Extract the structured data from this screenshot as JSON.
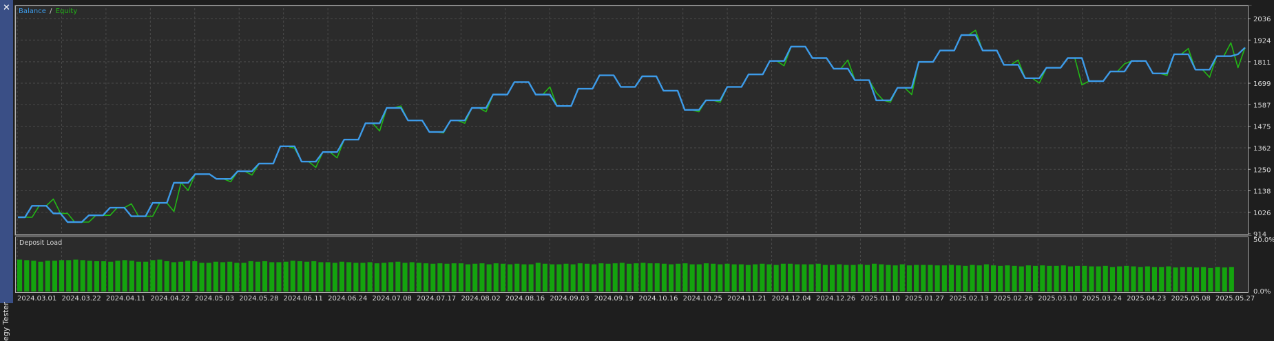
{
  "window": {
    "side_title": "egy Tester",
    "close_icon": "close-icon",
    "accent_color": "#3a4f86"
  },
  "legend": {
    "balance_label": "Balance",
    "separator": "/",
    "equity_label": "Equity"
  },
  "subchart": {
    "title": "Deposit Load"
  },
  "chart_data": [
    {
      "type": "line",
      "title": "",
      "legend": [
        "Balance",
        "Equity"
      ],
      "legend_position": "top-left",
      "grid": true,
      "ylim": [
        914,
        2090
      ],
      "y_ticks": [
        "914",
        "1026",
        "1138",
        "1250",
        "1362",
        "1475",
        "1587",
        "1699",
        "1811",
        "1924",
        "2036"
      ],
      "x_ticks": [
        "2024.03.01",
        "2024.03.22",
        "2024.04.11",
        "2024.04.22",
        "2024.05.03",
        "2024.05.28",
        "2024.06.11",
        "2024.06.24",
        "2024.07.08",
        "2024.07.17",
        "2024.08.02",
        "2024.08.16",
        "2024.09.03",
        "2024.09.19",
        "2024.10.16",
        "2024.10.25",
        "2024.11.21",
        "2024.12.04",
        "2024.12.26",
        "2025.01.10",
        "2025.01.27",
        "2025.02.13",
        "2025.02.26",
        "2025.03.10",
        "2025.03.24",
        "2025.04.23",
        "2025.05.08",
        "2025.05.27"
      ],
      "series": [
        {
          "name": "Balance",
          "color": "#3d9be9",
          "values": [
            1000,
            1000,
            1060,
            1060,
            1060,
            1020,
            1020,
            975,
            975,
            975,
            1010,
            1010,
            1010,
            1050,
            1050,
            1050,
            1005,
            1005,
            1005,
            1075,
            1075,
            1075,
            1180,
            1180,
            1180,
            1225,
            1225,
            1225,
            1200,
            1200,
            1200,
            1240,
            1240,
            1240,
            1280,
            1280,
            1280,
            1370,
            1370,
            1370,
            1290,
            1290,
            1290,
            1340,
            1340,
            1340,
            1405,
            1405,
            1405,
            1490,
            1490,
            1490,
            1570,
            1570,
            1570,
            1505,
            1505,
            1505,
            1445,
            1445,
            1445,
            1505,
            1505,
            1505,
            1570,
            1570,
            1570,
            1640,
            1640,
            1640,
            1705,
            1705,
            1705,
            1640,
            1640,
            1640,
            1580,
            1580,
            1580,
            1670,
            1670,
            1670,
            1740,
            1740,
            1740,
            1680,
            1680,
            1680,
            1735,
            1735,
            1735,
            1660,
            1660,
            1660,
            1560,
            1560,
            1560,
            1610,
            1610,
            1610,
            1680,
            1680,
            1680,
            1745,
            1745,
            1745,
            1815,
            1815,
            1815,
            1890,
            1890,
            1890,
            1830,
            1830,
            1830,
            1775,
            1775,
            1775,
            1715,
            1715,
            1715,
            1610,
            1610,
            1610,
            1675,
            1675,
            1675,
            1810,
            1810,
            1810,
            1870,
            1870,
            1870,
            1950,
            1950,
            1950,
            1870,
            1870,
            1870,
            1795,
            1795,
            1795,
            1725,
            1725,
            1725,
            1780,
            1780,
            1780,
            1830,
            1830,
            1830,
            1710,
            1710,
            1710,
            1760,
            1760,
            1760,
            1815,
            1815,
            1815,
            1750,
            1750,
            1750,
            1850,
            1850,
            1850,
            1770,
            1770,
            1770,
            1840,
            1840,
            1840,
            1850,
            1885
          ]
        },
        {
          "name": "Equity",
          "color": "#22b616",
          "values": [
            1000,
            1000,
            1000,
            1060,
            1060,
            1095,
            1020,
            1020,
            975,
            975,
            975,
            1010,
            1010,
            1010,
            1050,
            1050,
            1070,
            1005,
            1005,
            1005,
            1075,
            1075,
            1030,
            1180,
            1140,
            1225,
            1225,
            1225,
            1200,
            1200,
            1185,
            1240,
            1240,
            1220,
            1280,
            1280,
            1280,
            1370,
            1370,
            1360,
            1290,
            1290,
            1260,
            1340,
            1340,
            1310,
            1405,
            1405,
            1405,
            1490,
            1490,
            1450,
            1570,
            1570,
            1580,
            1505,
            1505,
            1505,
            1445,
            1445,
            1440,
            1505,
            1505,
            1490,
            1570,
            1570,
            1550,
            1640,
            1640,
            1640,
            1705,
            1705,
            1705,
            1640,
            1640,
            1680,
            1580,
            1580,
            1580,
            1670,
            1670,
            1670,
            1740,
            1740,
            1740,
            1680,
            1680,
            1680,
            1735,
            1735,
            1735,
            1660,
            1660,
            1660,
            1560,
            1560,
            1550,
            1610,
            1610,
            1600,
            1680,
            1680,
            1680,
            1745,
            1745,
            1745,
            1815,
            1815,
            1790,
            1890,
            1890,
            1890,
            1830,
            1830,
            1830,
            1775,
            1775,
            1820,
            1715,
            1715,
            1715,
            1650,
            1610,
            1600,
            1675,
            1675,
            1640,
            1810,
            1810,
            1810,
            1870,
            1870,
            1870,
            1950,
            1950,
            1975,
            1870,
            1870,
            1870,
            1795,
            1795,
            1820,
            1725,
            1725,
            1700,
            1780,
            1780,
            1780,
            1830,
            1830,
            1690,
            1710,
            1710,
            1710,
            1760,
            1760,
            1800,
            1815,
            1815,
            1815,
            1750,
            1750,
            1740,
            1850,
            1850,
            1880,
            1770,
            1770,
            1730,
            1840,
            1840,
            1910,
            1780,
            1885
          ]
        }
      ]
    },
    {
      "type": "bar",
      "title": "Deposit Load",
      "y_ticks": [
        "50.0%",
        "0.0%"
      ],
      "ylim": [
        0,
        50
      ],
      "values": [
        30.5,
        30,
        29.5,
        28.5,
        29.5,
        29.5,
        30,
        30,
        30.5,
        30,
        29.5,
        29,
        29,
        28.5,
        29.5,
        30,
        29.5,
        28.5,
        28.5,
        30,
        30.5,
        29,
        28,
        28.5,
        29.5,
        29,
        27.5,
        27.5,
        28.5,
        28,
        28.5,
        27.5,
        27.5,
        29,
        28.5,
        29,
        28,
        28,
        28.5,
        29.5,
        29,
        28.5,
        29,
        28,
        28,
        27.5,
        28.5,
        28,
        27.5,
        27.5,
        28,
        27,
        27.5,
        28,
        28.5,
        27.5,
        28,
        27.5,
        27,
        26.5,
        27,
        26.5,
        27,
        27,
        26,
        26.5,
        27,
        26,
        27,
        26.5,
        26,
        26.5,
        26,
        26,
        27.5,
        26.5,
        26,
        26,
        26.5,
        26,
        27,
        26.5,
        26,
        27,
        26.5,
        27,
        27.5,
        26.5,
        27,
        27.5,
        27,
        27,
        26.5,
        26,
        26.5,
        27,
        26,
        26,
        27,
        26.5,
        26,
        26.5,
        26,
        26,
        25.5,
        26,
        26.5,
        26,
        25.5,
        26.5,
        26.5,
        26,
        26,
        26,
        26.5,
        25.5,
        25.5,
        26,
        25.5,
        25.5,
        26,
        25.5,
        26.5,
        26,
        25.5,
        25,
        26,
        25,
        25.5,
        25.5,
        25.5,
        25,
        25,
        25.5,
        25,
        24.5,
        25.5,
        25,
        26,
        25,
        24.5,
        25,
        24.5,
        24,
        25,
        24.5,
        25,
        24.5,
        24.5,
        25,
        24,
        24.5,
        24.5,
        24,
        24,
        24.5,
        23.5,
        24,
        24.5,
        24,
        23.5,
        24,
        23.5,
        23.5,
        24,
        23,
        23.5,
        23.5,
        23,
        23.5,
        22.5,
        23.5,
        23,
        23.5
      ]
    }
  ]
}
